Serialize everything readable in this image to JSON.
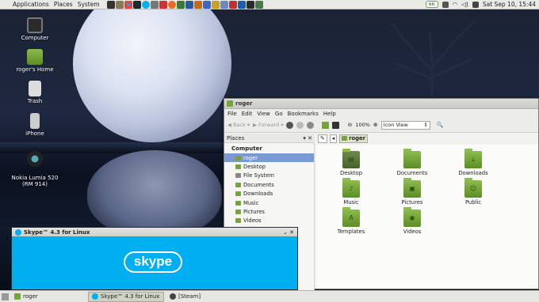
{
  "top_panel": {
    "menus": [
      "Applications",
      "Places",
      "System"
    ],
    "indicator": "on",
    "clock": "Sat Sep 10, 15:44"
  },
  "desktop_icons": [
    {
      "label": "Computer"
    },
    {
      "label": "roger's Home"
    },
    {
      "label": "Trash"
    },
    {
      "label": "iPhone"
    },
    {
      "label": "Nokia Lumia 520\n(RM 914)"
    }
  ],
  "file_manager": {
    "title": "roger",
    "menu": [
      "File",
      "Edit",
      "View",
      "Go",
      "Bookmarks",
      "Help"
    ],
    "toolbar": {
      "back": "Back",
      "forward": "Forward",
      "zoom": "100%",
      "view_mode": "Icon View"
    },
    "places_label": "Places",
    "sidebar_group": "Computer",
    "sidebar_items": [
      "roger",
      "Desktop",
      "File System",
      "Documents",
      "Downloads",
      "Music",
      "Pictures",
      "Videos"
    ],
    "path_current": "roger",
    "folders": [
      "Desktop",
      "Documents",
      "Downloads",
      "Music",
      "Pictures",
      "Public",
      "Templates",
      "Videos"
    ]
  },
  "skype": {
    "title": "Skype™ 4.3 for Linux",
    "logo_text": "skype"
  },
  "taskbar": [
    "roger",
    "Skype™ 4.3 for Linux",
    "[Steam]"
  ],
  "colors": {
    "skype_blue": "#00aff0",
    "folder_green": "#76a33a",
    "selection": "#7a9ad3"
  }
}
